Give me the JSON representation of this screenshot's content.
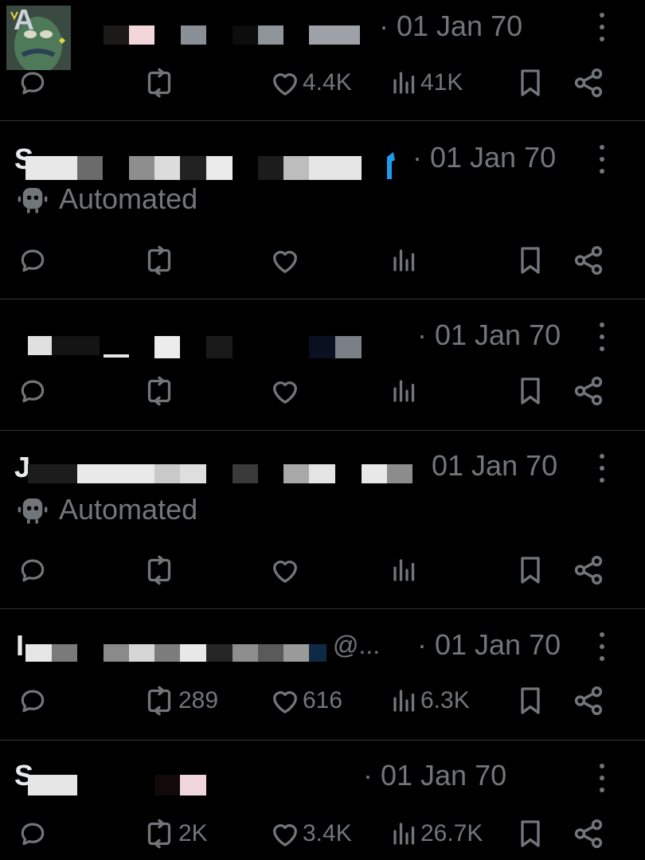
{
  "tweets": [
    {
      "date": "· 01 Jan 70",
      "reply": "",
      "retweet": "",
      "like": "4.4K",
      "views": "41K",
      "name_stub": "A"
    },
    {
      "date": "· 01 Jan 70",
      "reply": "",
      "retweet": "",
      "like": "",
      "views": "",
      "automated": "Automated",
      "name_stub": "S"
    },
    {
      "date": "· 01 Jan 70",
      "reply": "",
      "retweet": "",
      "like": "",
      "views": "",
      "name_stub": ""
    },
    {
      "date": "01 Jan 70",
      "reply": "",
      "retweet": "",
      "like": "",
      "views": "",
      "automated": "Automated",
      "name_stub": "J"
    },
    {
      "date": "· 01 Jan 70",
      "reply": "",
      "retweet": "289",
      "like": "616",
      "views": "6.3K",
      "handle_tail": "@...",
      "name_stub": "I"
    },
    {
      "date": "· 01 Jan 70",
      "reply": "",
      "retweet": "2K",
      "like": "3.4K",
      "views": "26.7K",
      "name_stub": "S"
    }
  ],
  "colors": {
    "background": "#000000",
    "muted": "#71767b",
    "divider": "#2f3336",
    "verified": "#1d9bf0"
  },
  "icons": [
    "reply-icon",
    "retweet-icon",
    "like-icon",
    "views-icon",
    "bookmark-icon",
    "share-icon",
    "more-icon",
    "robot-icon"
  ]
}
